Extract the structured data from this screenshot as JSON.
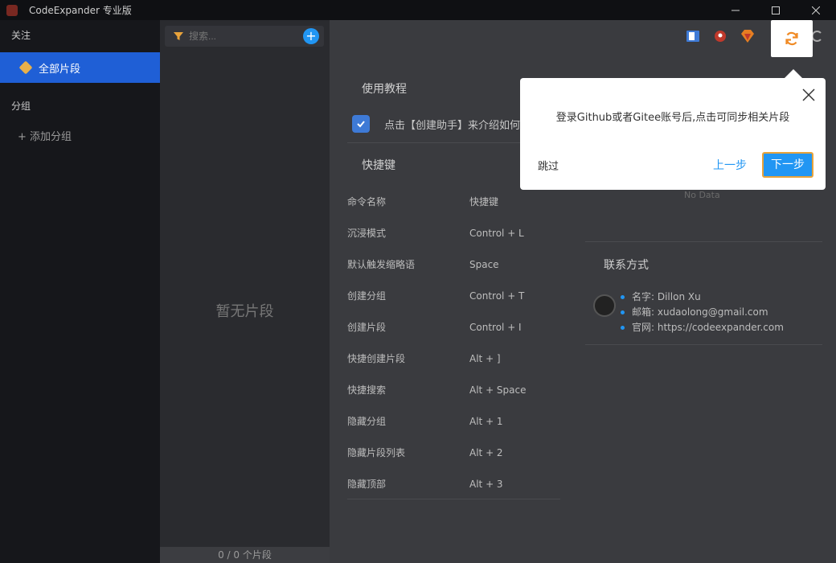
{
  "window": {
    "title": "CodeExpander 专业版"
  },
  "sidebar": {
    "follow_label": "关注",
    "all_snippets_label": "全部片段",
    "group_label": "分组",
    "add_group_label": "+ 添加分组"
  },
  "list_panel": {
    "search_placeholder": "搜索...",
    "empty_text": "暂无片段",
    "footer_count": "0 / 0 个片段"
  },
  "main": {
    "tutorial_title": "使用教程",
    "tutorial_item": "点击【创建助手】来介绍如何",
    "shortcut_title": "快捷键",
    "shortcut_header": {
      "cmd": "命令名称",
      "key": "快捷键"
    },
    "shortcuts": [
      {
        "cmd": "沉浸模式",
        "key": "Control + L"
      },
      {
        "cmd": "默认触发缩略语",
        "key": "Space"
      },
      {
        "cmd": "创建分组",
        "key": "Control + T"
      },
      {
        "cmd": "创建片段",
        "key": "Control + I"
      },
      {
        "cmd": "快捷创建片段",
        "key": "Alt + ]"
      },
      {
        "cmd": "快捷搜索",
        "key": "Alt + Space"
      },
      {
        "cmd": "隐藏分组",
        "key": "Alt + 1"
      },
      {
        "cmd": "隐藏片段列表",
        "key": "Alt + 2"
      },
      {
        "cmd": "隐藏顶部",
        "key": "Alt + 3"
      }
    ],
    "no_data": "No Data",
    "contact_title": "联系方式",
    "contact": [
      "名字: Dillon Xu",
      "邮箱: xudaolong@gmail.com",
      "官网: https://codeexpander.com"
    ]
  },
  "popover": {
    "message": "登录Github或者Gitee账号后,点击可同步相关片段",
    "skip": "跳过",
    "prev": "上一步",
    "next": "下一步"
  },
  "colors": {
    "accent": "#2196f3",
    "sync_orange": "#f08a24",
    "active_blue": "#1f5fd6"
  },
  "icons": [
    "filter-icon",
    "add-icon",
    "book-icon",
    "rocket-icon",
    "gem-icon",
    "sync-icon",
    "c-logo-icon",
    "close-icon",
    "tag-icon",
    "check-icon"
  ]
}
